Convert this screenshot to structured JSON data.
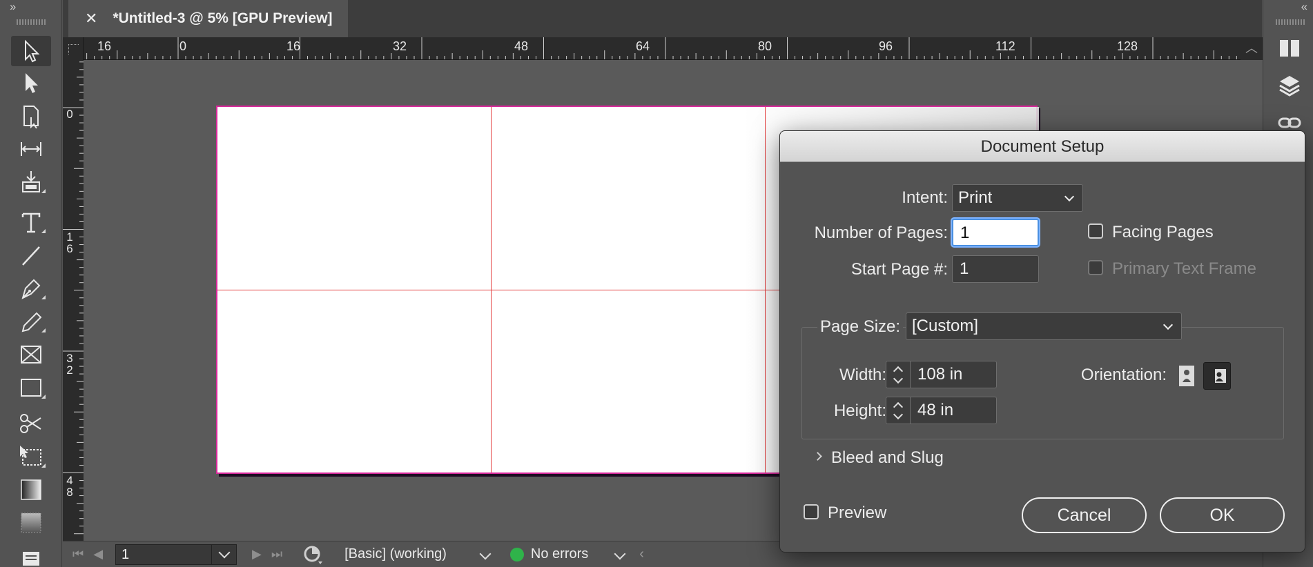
{
  "document_tab": {
    "close_glyph": "✕",
    "title": "*Untitled-3 @ 5% [GPU Preview]"
  },
  "toolbar": {
    "collapse_glyph": "››",
    "tools": [
      {
        "name": "selection-tool-icon",
        "selected": true
      },
      {
        "name": "direct-selection-tool-icon"
      },
      {
        "name": "page-tool-icon"
      },
      {
        "name": "gap-tool-icon"
      },
      {
        "name": "content-collector-tool-icon"
      },
      {
        "name": "type-tool-icon"
      },
      {
        "name": "line-tool-icon"
      },
      {
        "name": "pen-tool-icon"
      },
      {
        "name": "pencil-tool-icon"
      },
      {
        "name": "rectangle-frame-tool-icon"
      },
      {
        "name": "rectangle-tool-icon"
      },
      {
        "name": "scissors-tool-icon"
      },
      {
        "name": "free-transform-tool-icon"
      },
      {
        "name": "gradient-swatch-tool-icon"
      },
      {
        "name": "gradient-feather-tool-icon"
      },
      {
        "name": "note-tool-icon"
      }
    ]
  },
  "right_panel": {
    "collapse_glyph": "‹‹",
    "icons": [
      "pages-panel-icon",
      "layers-panel-icon",
      "links-panel-icon"
    ]
  },
  "rulers": {
    "horizontal_labels": [
      "16",
      "0",
      "16",
      "32",
      "48",
      "64",
      "80",
      "96",
      "112",
      "128"
    ],
    "vertical_labels": [
      "0",
      "1\n6",
      "3\n2",
      "4\n8"
    ]
  },
  "status_bar": {
    "page_number": "1",
    "preflight_profile": "[Basic] (working)",
    "errors": "No errors"
  },
  "dialog": {
    "title": "Document Setup",
    "intent_label": "Intent:",
    "intent_value": "Print",
    "pages_label": "Number of Pages:",
    "pages_value": "1",
    "facing_pages_label": "Facing Pages",
    "facing_pages_checked": false,
    "start_page_label": "Start Page #:",
    "start_page_value": "1",
    "primary_text_frame_label": "Primary Text Frame",
    "primary_text_frame_checked": false,
    "page_size_label": "Page Size:",
    "page_size_value": "[Custom]",
    "width_label": "Width:",
    "width_value": "108 in",
    "height_label": "Height:",
    "height_value": "48 in",
    "orientation_label": "Orientation:",
    "orientation_selected": "landscape",
    "bleed_slug_label": "Bleed and Slug",
    "preview_label": "Preview",
    "preview_checked": false,
    "cancel_label": "Cancel",
    "ok_label": "OK"
  },
  "colors": {
    "page_border": "#d8289b",
    "guides": "#e33b3b",
    "status_ok": "#2fb34a",
    "focus_ring": "#4a90e2"
  }
}
